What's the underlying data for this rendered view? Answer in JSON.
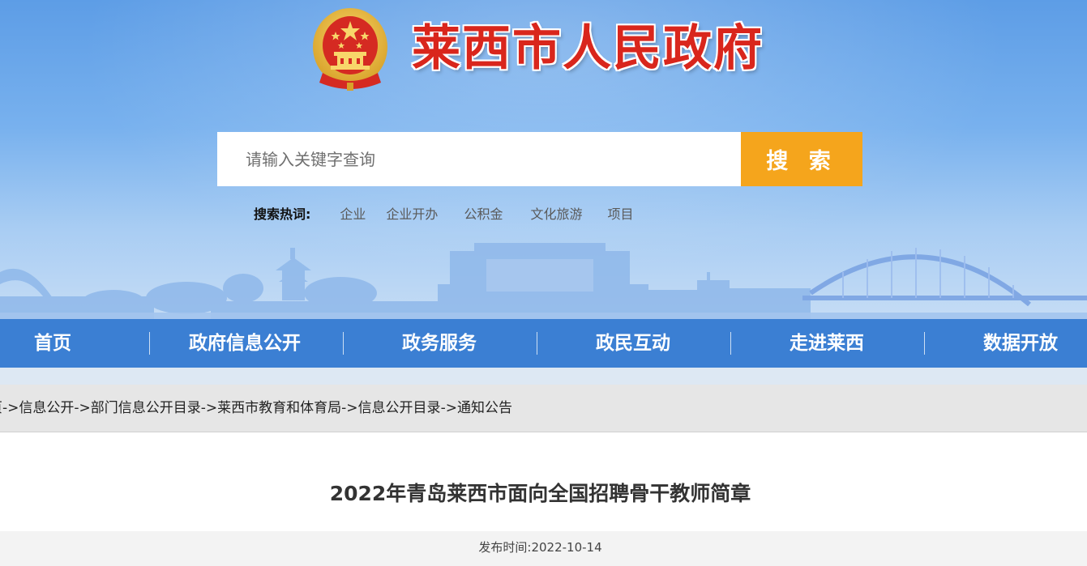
{
  "header": {
    "site_title": "莱西市人民政府",
    "search_placeholder": "请输入关键字查询",
    "search_button": "搜 索",
    "hot_label": "搜索热词:",
    "hot_words": [
      "企业",
      "企业开办",
      "公积金",
      "文化旅游",
      "项目"
    ],
    "colors": {
      "title_red": "#d9261c",
      "search_orange": "#f5a51c",
      "sky_blue": "#5d9de6"
    }
  },
  "nav": {
    "items": [
      "首页",
      "政府信息公开",
      "政务服务",
      "政民互动",
      "走进莱西",
      "数据开放"
    ],
    "color": "#3b7fd3"
  },
  "breadcrumb": {
    "items": [
      "页",
      "信息公开",
      "部门信息公开目录",
      "莱西市教育和体育局",
      "信息公开目录",
      "通知公告"
    ],
    "separator": "->"
  },
  "article": {
    "title": "2022年青岛莱西市面向全国招聘骨干教师简章",
    "meta_label": "发布时间:",
    "publish_date": "2022-10-14"
  }
}
